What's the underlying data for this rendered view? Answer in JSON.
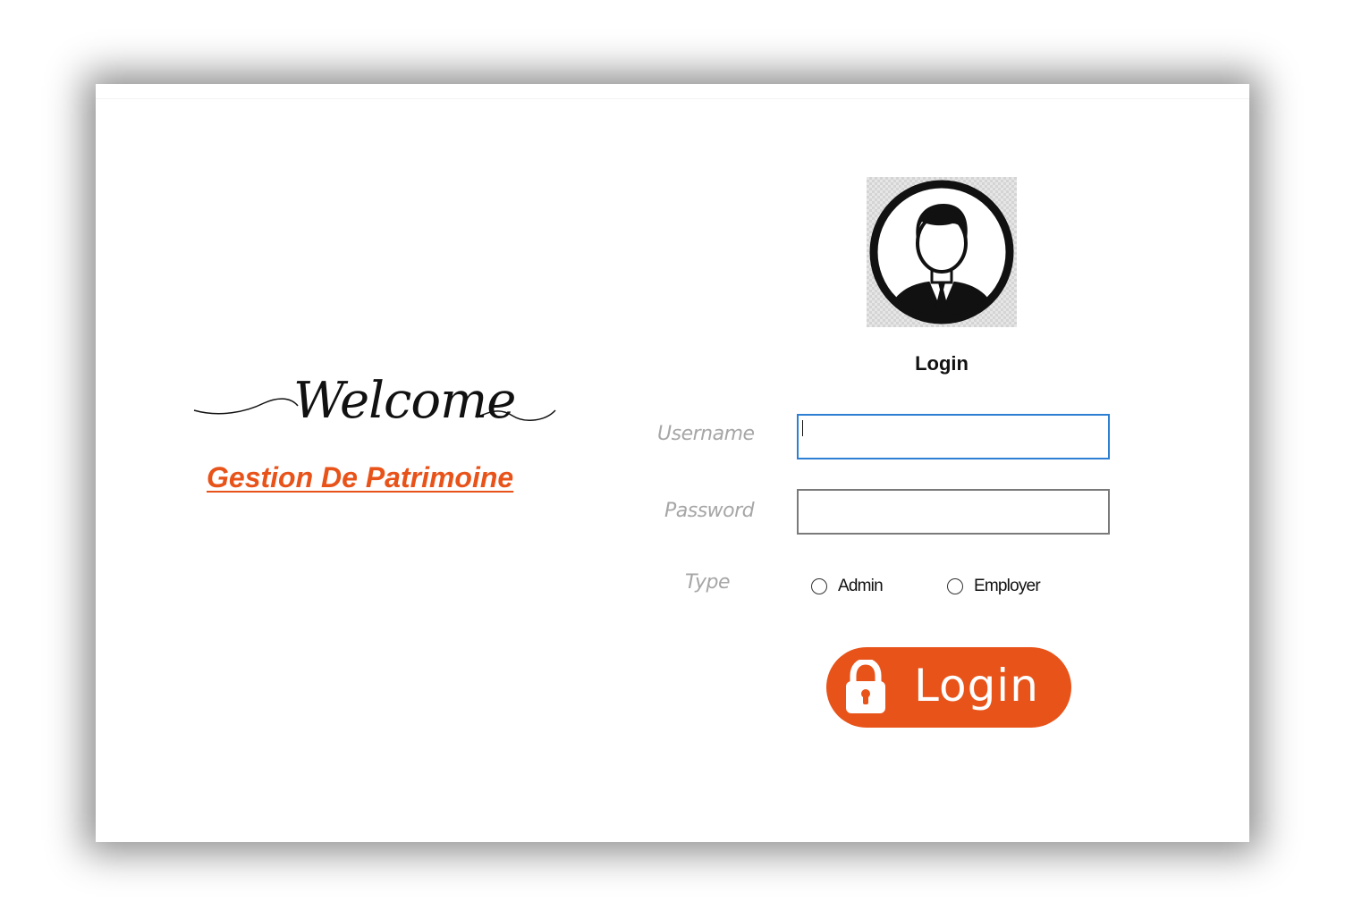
{
  "welcome": {
    "greeting": "Welcome",
    "app_title": "Gestion De Patrimoine"
  },
  "login_form": {
    "heading": "Login",
    "avatar_icon": "user-avatar-icon",
    "username_label": "Username",
    "username_value": "",
    "password_label": "Password",
    "password_value": "",
    "type_label": "Type",
    "type_options": [
      {
        "label": "Admin",
        "selected": false
      },
      {
        "label": "Employer",
        "selected": false
      }
    ],
    "submit_label": "Login",
    "submit_icon": "lock-icon"
  },
  "colors": {
    "accent": "#e8531a",
    "focus_border": "#2d7fd3",
    "label_gray": "#a6a6a6"
  }
}
